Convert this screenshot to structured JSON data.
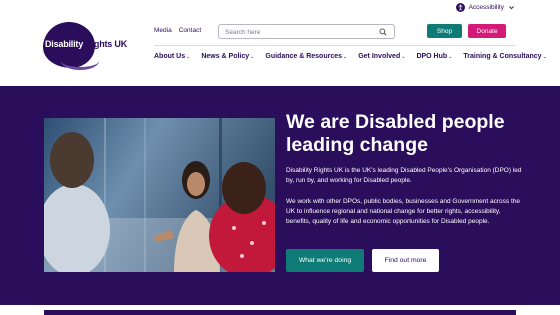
{
  "topbar": {
    "accessibility_label": "Accessibility",
    "accessibility_icon": "accessibility-icon"
  },
  "brand": {
    "logo_text_first": "Disability",
    "logo_text_rest": " Rights UK"
  },
  "header": {
    "util_links": [
      "Media",
      "Contact"
    ],
    "search_placeholder": "Search here",
    "shop_label": "Shop",
    "donate_label": "Donate",
    "colors": {
      "brand_purple": "#2a0d5b",
      "teal": "#0f7b76",
      "pink": "#d21a76"
    }
  },
  "nav": {
    "items": [
      {
        "label": "About Us"
      },
      {
        "label": "News & Policy"
      },
      {
        "label": "Guidance & Resources"
      },
      {
        "label": "Get Involved"
      },
      {
        "label": "DPO Hub"
      },
      {
        "label": "Training & Consultancy"
      }
    ],
    "chevron": "⌄"
  },
  "hero": {
    "title": "We are Disabled people leading change",
    "paragraph1": "Disability Rights UK is the UK's leading Disabled People's Organisation (DPO) led by, run by, and working for Disabled people.",
    "paragraph2": "We work with other DPOs, public bodies, businesses and Government across the UK to influence regional and national change for better rights, accessibility, benefits, quality of life and economic opportunities for Disabled people.",
    "primary_button": "What we're doing",
    "secondary_button": "Find out more"
  }
}
